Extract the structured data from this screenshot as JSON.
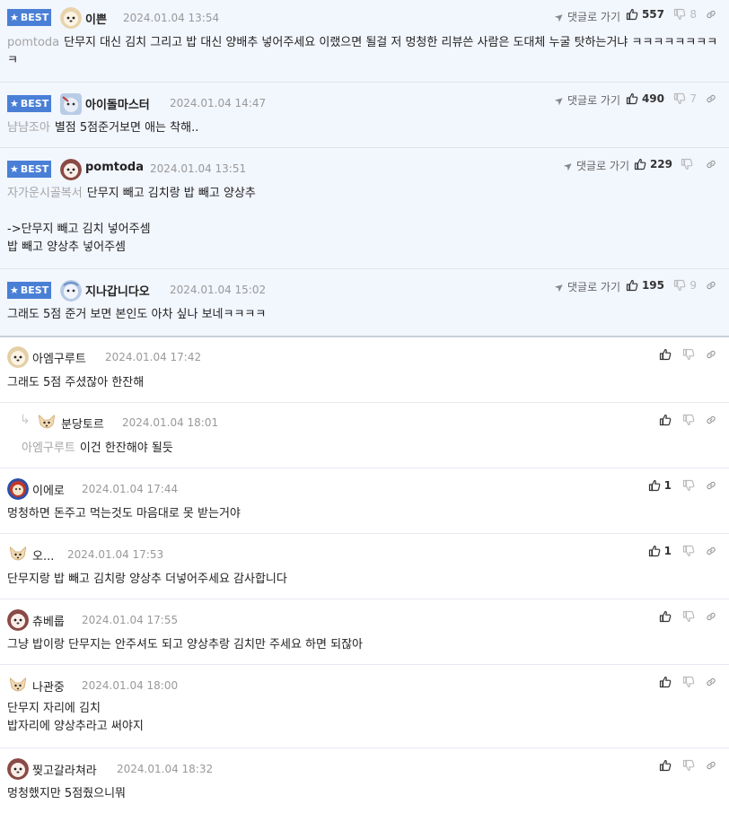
{
  "best_label": "BEST",
  "reply_link_label": "댓글로 가기",
  "best_comments": [
    {
      "nick": "이쁜",
      "date": "2024.01.04 13:54",
      "likes": "557",
      "dislikes": "8",
      "mention": "pomtoda",
      "text": "단무지 대신 김치 그리고 밥 대신 양배추 넣어주세요 이랬으면 될걸 저 멍청한 리뷰쓴 사람은 도대체 누굴 탓하는거냐 ㅋㅋㅋㅋㅋㅋㅋㅋㅋ"
    },
    {
      "nick": "아이돌마스터",
      "date": "2024.01.04 14:47",
      "likes": "490",
      "dislikes": "7",
      "mention": "냠냠조아",
      "text": "별점 5점준거보면 애는 착해.."
    },
    {
      "nick": "pomtoda",
      "date": "2024.01.04 13:51",
      "likes": "229",
      "dislikes": "",
      "mention": "자가운시골복서",
      "text": "단무지 빼고 김치랑 밥 빼고 양상추\n\n->단무지 빼고 김치 넣어주셈\n밥 빼고 양상추 넣어주셈"
    },
    {
      "nick": "지나갑니다오",
      "date": "2024.01.04 15:02",
      "likes": "195",
      "dislikes": "9",
      "mention": "",
      "text": "그래도 5점 준거 보면 본인도 아차 싶나 보네ㅋㅋㅋㅋ"
    }
  ],
  "comments": [
    {
      "nick": "아엠구루트",
      "date": "2024.01.04 17:42",
      "likes": "",
      "mention": "",
      "text": "그래도 5점 주셨잖아 한잔해"
    },
    {
      "nick": "분당토르",
      "date": "2024.01.04 18:01",
      "likes": "",
      "mention": "아엠구루트",
      "text": "이건 한잔해야 될듯"
    },
    {
      "nick": "이에로",
      "date": "2024.01.04 17:44",
      "likes": "1",
      "mention": "",
      "text": "멍청하면 돈주고 먹는것도 마음대로 못 받는거야"
    },
    {
      "nick": "오...",
      "date": "2024.01.04 17:53",
      "likes": "1",
      "mention": "",
      "text": "단무지랑 밥 빼고 김치랑 양상추 더넣어주세요 감사합니다"
    },
    {
      "nick": "츄베룹",
      "date": "2024.01.04 17:55",
      "likes": "",
      "mention": "",
      "text": "그냥 밥이랑 단무지는 안주셔도 되고 양상추랑 김치만 주세요 하면 되잖아"
    },
    {
      "nick": "나관중",
      "date": "2024.01.04 18:00",
      "likes": "",
      "mention": "",
      "text": "단무지 자리에 김치\n밥자리에 양상추라고 써야지"
    },
    {
      "nick": "찢고갈라쳐라",
      "date": "2024.01.04 18:32",
      "likes": "",
      "mention": "",
      "text": "멍청했지만 5점줬으니뭐"
    }
  ],
  "icons": {
    "reply_link": "send-arrow-icon",
    "like": "thumbs-up-icon",
    "dislike": "thumbs-down-icon",
    "share": "link-icon",
    "star": "star-icon",
    "reply_indicator": "reply-arrow-icon"
  },
  "colors": {
    "best_badge": "#4a7fd6",
    "best_bg": "#f2f6fd",
    "muted": "#a5a5a5"
  }
}
